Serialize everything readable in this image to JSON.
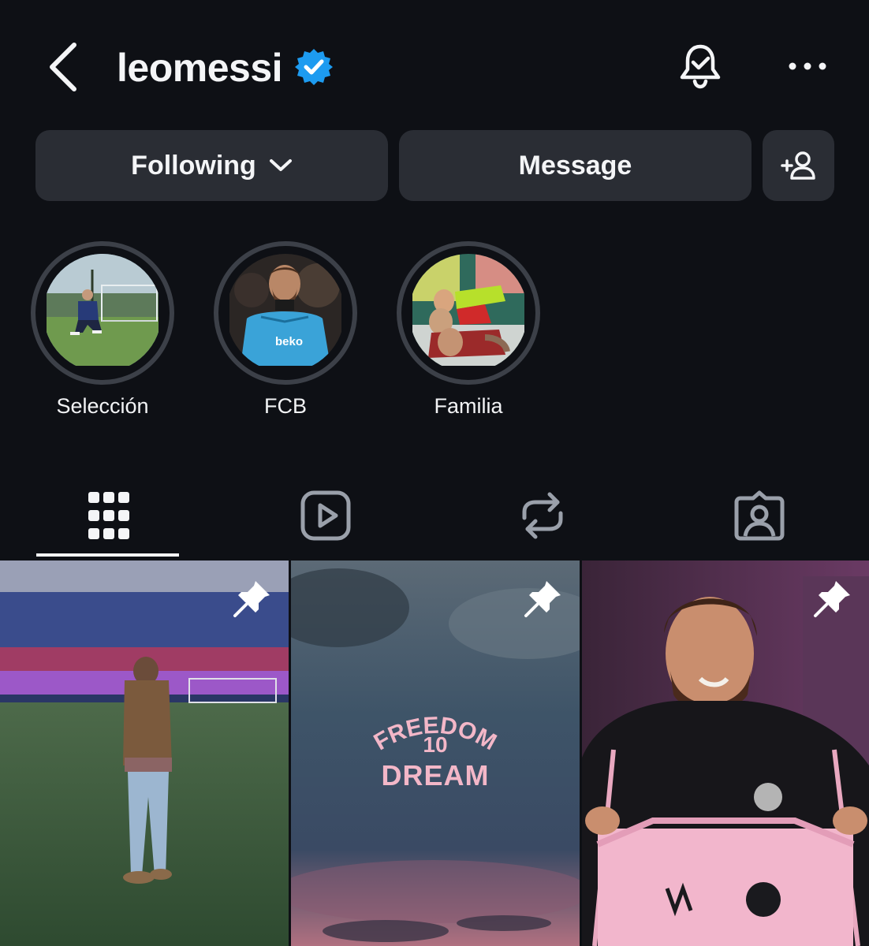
{
  "header": {
    "username": "leomessi",
    "icons": {
      "back": "chevron-left-icon",
      "verified": "verified-badge-icon",
      "notifications": "bell-check-icon",
      "more": "more-horizontal-icon"
    },
    "accent_color": "#1d9bf0"
  },
  "actions": {
    "following_label": "Following",
    "message_label": "Message",
    "add_user_icon": "add-person-icon"
  },
  "highlights": [
    {
      "label": "Selección"
    },
    {
      "label": "FCB"
    },
    {
      "label": "Familia"
    }
  ],
  "tabs": [
    {
      "name": "posts",
      "icon": "grid-icon",
      "active": true
    },
    {
      "name": "reels",
      "icon": "reels-play-icon",
      "active": false
    },
    {
      "name": "reposts",
      "icon": "repost-icon",
      "active": false
    },
    {
      "name": "tagged",
      "icon": "tagged-person-icon",
      "active": false
    }
  ],
  "posts": [
    {
      "pinned": true,
      "scene": "stadium"
    },
    {
      "pinned": true,
      "scene": "sky",
      "overlay_text": {
        "top": "FREEDOM",
        "middle": "10",
        "bottom": "DREAM"
      }
    },
    {
      "pinned": true,
      "scene": "portrait-pink-jersey"
    }
  ]
}
